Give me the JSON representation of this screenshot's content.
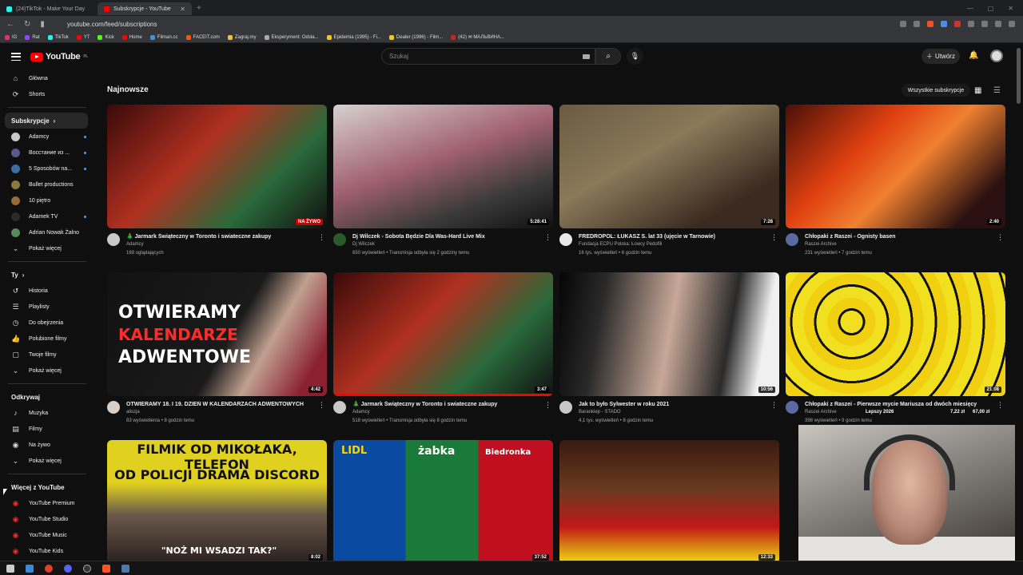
{
  "browser": {
    "tabs": [
      {
        "label": "(24)TikTok - Make Your Day",
        "color": "#25f4ee"
      },
      {
        "label": "Subskrypcje - YouTube",
        "color": "#ff0000"
      }
    ],
    "url": "youtube.com/feed/subscriptions",
    "bookmarks": [
      {
        "label": "IG",
        "color": "#e1306c"
      },
      {
        "label": "Rat",
        "color": "#9146ff"
      },
      {
        "label": "TikTok",
        "color": "#25f4ee"
      },
      {
        "label": "YT",
        "color": "#ff0000"
      },
      {
        "label": "Kick",
        "color": "#53fc18"
      },
      {
        "label": "Home",
        "color": "#ff0000"
      },
      {
        "label": "Filman.cc",
        "color": "#4a90d9"
      },
      {
        "label": "FACEIT.com",
        "color": "#ff5500"
      },
      {
        "label": "Zagraj.my",
        "color": "#f0c040"
      },
      {
        "label": "Eksperyment: Odsła...",
        "color": "#aaaaaa"
      },
      {
        "label": "Epidemia (1995) - Fi...",
        "color": "#f5c518"
      },
      {
        "label": "Dealer (1996) - Film...",
        "color": "#f5c518"
      },
      {
        "label": "(42) ✉ МАЛЬВИНА...",
        "color": "#cc2222"
      }
    ]
  },
  "header": {
    "logo_text": "YouTube",
    "region": "PL",
    "search_placeholder": "Szukaj",
    "create_label": "Utwórz"
  },
  "sidebar": {
    "top": [
      {
        "label": "Główna",
        "icon": "⌂",
        "name": "home"
      },
      {
        "label": "Shorts",
        "icon": "⟳",
        "name": "shorts"
      }
    ],
    "subs_heading": "Subskrypcje",
    "channels": [
      {
        "label": "Adamcy",
        "color": "#c8c8c8",
        "live": true
      },
      {
        "label": "Восстание из ...",
        "color": "#5a5a8a",
        "live": true
      },
      {
        "label": "5 Sposobów na...",
        "color": "#3a6ea5",
        "live": true
      },
      {
        "label": "Bullet productions",
        "color": "#8a7a40",
        "live": false
      },
      {
        "label": "10 piętro",
        "color": "#9a6a3a",
        "live": false
      },
      {
        "label": "Adamek TV",
        "color": "#2a2a2a",
        "live": true
      },
      {
        "label": "Adrian Nowak Żalno",
        "color": "#5a8a5a",
        "live": false
      }
    ],
    "subs_more": "Pokaż więcej",
    "you_heading": "Ty",
    "you_items": [
      {
        "label": "Historia",
        "icon": "↺",
        "name": "history"
      },
      {
        "label": "Playlisty",
        "icon": "☰",
        "name": "playlists"
      },
      {
        "label": "Do obejrzenia",
        "icon": "◷",
        "name": "watch-later"
      },
      {
        "label": "Polubione filmy",
        "icon": "👍",
        "name": "liked"
      },
      {
        "label": "Twoje filmy",
        "icon": "▢",
        "name": "your-videos"
      },
      {
        "label": "Pokaż więcej",
        "icon": "⌄",
        "name": "you-more"
      }
    ],
    "explore_heading": "Odkrywaj",
    "explore_items": [
      {
        "label": "Muzyka",
        "icon": "♪",
        "name": "music"
      },
      {
        "label": "Filmy",
        "icon": "▤",
        "name": "movies"
      },
      {
        "label": "Na żywo",
        "icon": "◉",
        "name": "live"
      },
      {
        "label": "Pokaż więcej",
        "icon": "⌄",
        "name": "explore-more"
      }
    ],
    "more_heading": "Więcej z YouTube",
    "more_items": [
      {
        "label": "YouTube Premium",
        "name": "premium"
      },
      {
        "label": "YouTube Studio",
        "name": "studio"
      },
      {
        "label": "YouTube Music",
        "name": "music-app"
      },
      {
        "label": "YouTube Kids",
        "name": "kids"
      }
    ]
  },
  "main": {
    "title": "Najnowsze",
    "all_subs": "Wszystkie subskrypcje",
    "videos": [
      {
        "title": "🎄 Jarmark Świąteczny w Toronto i swiateczne zakupy",
        "channel": "Adamcy",
        "stats": "169 oglądających",
        "duration": "NA ŻYWO",
        "live": true,
        "progress": 0,
        "bg": "linear-gradient(135deg,#3a0a0a,#b03020 40%,#2a6a3a 70%,#101010)",
        "ch_color": "#c8c8c8"
      },
      {
        "title": "Dj Wilczek - Sobota Będzie Dla Was-Hard Live Mix",
        "channel": "Dj Wilczek",
        "stats": "650 wyświetleń • Transmisja odbyła się 2 godziny temu",
        "duration": "5:28:41",
        "live": false,
        "progress": 0,
        "bg": "linear-gradient(160deg,#d8d0d0,#a06070 45%,#3a3a3a 75%,#101010)",
        "ch_color": "#2a5a2a"
      },
      {
        "title": "FREDROPOL: ŁUKASZ S. lat 33 (ujęcie w Tarnowie)",
        "channel": "Fundacja ECPU Polska: Łowcy Pedofili",
        "stats": "16 tys. wyświetleń • 6 godzin temu",
        "duration": "7:28",
        "live": false,
        "progress": 0,
        "bg": "linear-gradient(150deg,#6a5a40,#8a7a5a 40%,#3a2a20 80%)",
        "ch_color": "#e8e8e8"
      },
      {
        "title": "Chłopaki z Raszei - Ognisty basen",
        "channel": "Raszei Archive",
        "stats": "231 wyświetleń • 7 godzin temu",
        "duration": "2:40",
        "live": false,
        "progress": 0,
        "bg": "linear-gradient(135deg,#4a1008,#e04010 35%,#f08030 55%,#2a1010 85%)",
        "ch_color": "#5a6aa0"
      },
      {
        "title": "OTWIERAMY 18. I 19. DZIEŃ W KALENDARZACH ADWENTOWYCH",
        "channel": "aliszja",
        "stats": "83 wyświetlenia • 8 godzin temu",
        "duration": "4:42",
        "live": false,
        "progress": 0,
        "bg": "linear-gradient(120deg,#121212 0%,#1a1a1a 55%,#c0a090 70%,#8a2030 90%)",
        "ch_color": "#d8d0c8",
        "overlay": [
          "OTWIERAMY",
          "KALENDARZE",
          "ADWENTOWE"
        ]
      },
      {
        "title": "🎄 Jarmark Świąteczny w Toronto i swiateczne zakupy",
        "channel": "Adamcy",
        "stats": "518 wyświetleń • Transmisja odbyła się 8 godzin temu",
        "duration": "3:47",
        "live": false,
        "progress": 100,
        "bg": "linear-gradient(135deg,#3a0a0a,#b03020 40%,#2a6a3a 70%,#101010)",
        "ch_color": "#c8c8c8"
      },
      {
        "title": "Jak to było Sylwester w roku 2021",
        "channel": "Barankiep - STADO",
        "stats": "4,1 tys. wyświetleń • 8 godzin temu",
        "duration": "10:56",
        "live": false,
        "progress": 0,
        "bg": "linear-gradient(100deg,#050505 0%,#2a2a2a 20%,#c8a898 50%,#2a2a2a 75%,#f0f0f0 90%)",
        "ch_color": "#c8c8c8"
      },
      {
        "title": "Chłopaki z Raszei - Pierwsze mycie Mariusza od dwóch miesięcy",
        "channel": "Raszei Archive",
        "stats": "398 wyświetleń • 9 godzin temu",
        "duration": "21:08",
        "live": false,
        "progress": 0,
        "bg": "repeating-radial-gradient(circle at 30% 40%,#f0e020 0 14px,#101010 14px 17px,#f0d010 17px 30px)",
        "ch_color": "#5a6aa0"
      },
      {
        "title": "",
        "channel": "",
        "stats": "",
        "duration": "8:02",
        "live": false,
        "progress": 0,
        "bg": "linear-gradient(180deg,#e0d020 0%,#e0d020 35%,#6a5a4a 60%,#2a2020 100%)",
        "ch_color": "#888888",
        "overlay": [
          "FILMIK OD MIKOŁAKA, TELEFON",
          "OD POLICJI DRAMA DISCORD",
          "\"NOŻ MI WSADZI TAK?\""
        ]
      },
      {
        "title": "",
        "channel": "",
        "stats": "",
        "duration": "37:52",
        "live": false,
        "progress": 0,
        "bg": "linear-gradient(90deg,#0a4aa0 0%,#0a4aa0 33%,#1a7a3a 33%,#1a7a3a 66%,#c01020 66%,#c01020 100%)",
        "ch_color": "#888888",
        "overlay": [
          "LIDL",
          "żabka",
          "Biedronka"
        ]
      },
      {
        "title": "",
        "channel": "",
        "stats": "",
        "duration": "12:33",
        "live": false,
        "progress": 0,
        "bg": "linear-gradient(180deg,#3a1a10 0%,#6a3a20 40%,#c01818 70%,#f0e010 100%)",
        "ch_color": "#888888"
      }
    ],
    "price_tag": "Lepszy 2026",
    "price_1": "7,22 zł",
    "price_2": "67,00 zł"
  }
}
